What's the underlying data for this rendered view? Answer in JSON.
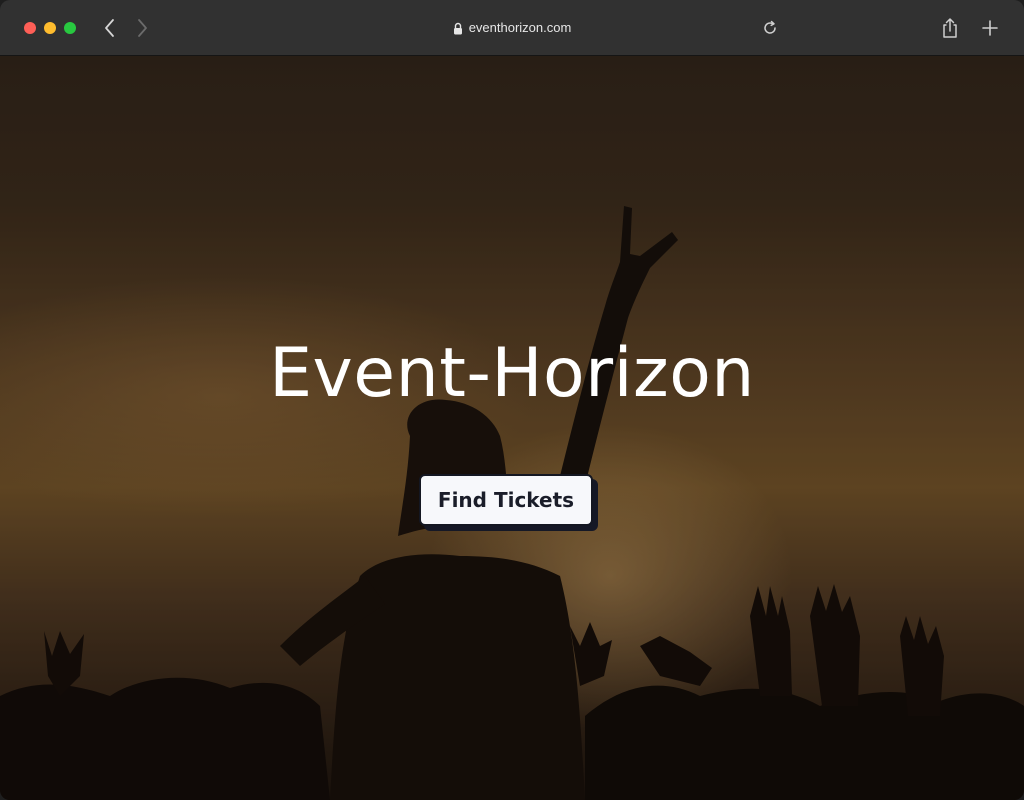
{
  "browser": {
    "url": "eventhorizon.com",
    "icons": {
      "back": "chevron-left-icon",
      "forward": "chevron-right-icon",
      "lock": "lock-icon",
      "reload": "reload-icon",
      "share": "share-icon",
      "new_tab": "plus-icon"
    },
    "traffic_colors": {
      "close": "#fe5f57",
      "minimize": "#febc2e",
      "maximize": "#28c840"
    }
  },
  "hero": {
    "title": "Event-Horizon",
    "cta_label": "Find Tickets"
  },
  "colors": {
    "title_text": "#ffffff",
    "cta_background": "#f7f8fb",
    "cta_text": "#1a1d29",
    "cta_shadow": "#151826"
  }
}
